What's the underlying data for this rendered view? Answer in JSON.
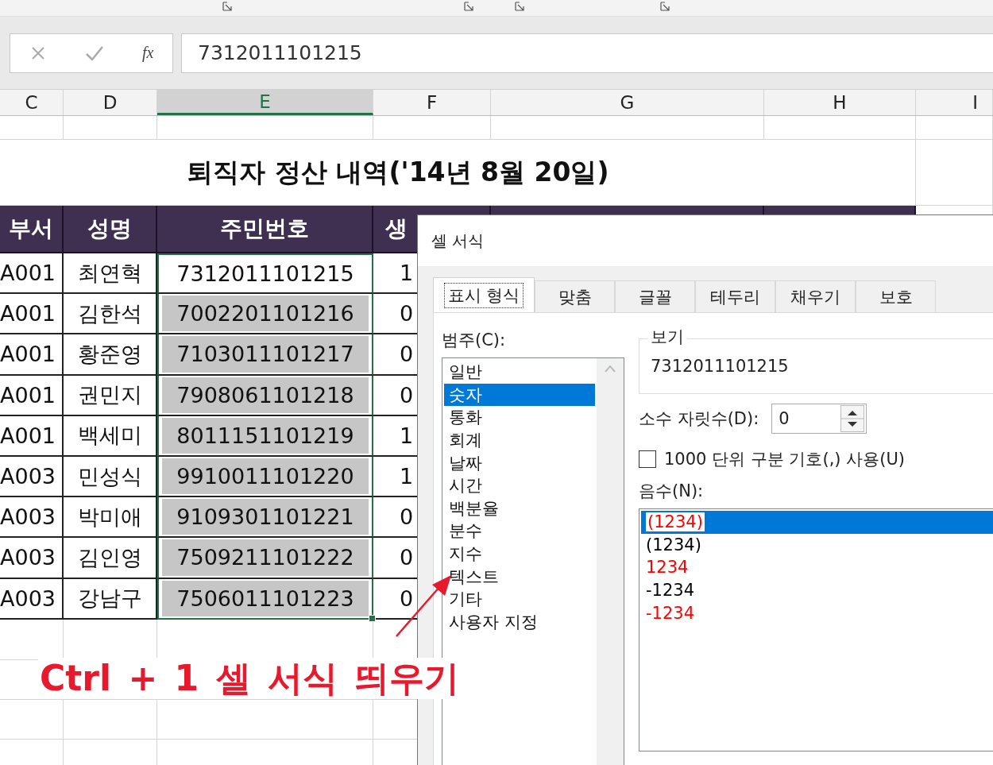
{
  "formula_bar": {
    "function_symbol": "fx",
    "value": "7312011101215"
  },
  "columns": [
    {
      "letter": "C",
      "selected": false
    },
    {
      "letter": "D",
      "selected": false
    },
    {
      "letter": "E",
      "selected": true
    },
    {
      "letter": "F",
      "selected": false
    },
    {
      "letter": "G",
      "selected": false
    },
    {
      "letter": "H",
      "selected": false
    },
    {
      "letter": "I",
      "selected": false
    }
  ],
  "sheet": {
    "title": "퇴직자 정산 내역('14년 8월 20일)",
    "headers": [
      "부서",
      "성명",
      "주민번호",
      "생"
    ],
    "rows": [
      {
        "dept": "A001",
        "name": "최연혁",
        "id": "7312011101215",
        "col_f": "1",
        "active": true
      },
      {
        "dept": "A001",
        "name": "김한석",
        "id": "7002201101216",
        "col_f": "0",
        "active": false
      },
      {
        "dept": "A001",
        "name": "황준영",
        "id": "7103011101217",
        "col_f": "0",
        "active": false
      },
      {
        "dept": "A001",
        "name": "권민지",
        "id": "7908061101218",
        "col_f": "0",
        "active": false
      },
      {
        "dept": "A001",
        "name": "백세미",
        "id": "8011151101219",
        "col_f": "1",
        "active": false
      },
      {
        "dept": "A003",
        "name": "민성식",
        "id": "9910011101220",
        "col_f": "1",
        "active": false
      },
      {
        "dept": "A003",
        "name": "박미애",
        "id": "9109301101221",
        "col_f": "0",
        "active": false
      },
      {
        "dept": "A003",
        "name": "김인영",
        "id": "7509211101222",
        "col_f": "0",
        "active": false
      },
      {
        "dept": "A003",
        "name": "강남구",
        "id": "7506011101223",
        "col_f": "0",
        "active": false
      }
    ]
  },
  "annotation": "Ctrl + 1 셀 서식 띄우기",
  "dialog": {
    "title": "셀 서식",
    "tabs": [
      {
        "label": "표시 형식",
        "selected": true
      },
      {
        "label": "맞춤",
        "selected": false
      },
      {
        "label": "글꼴",
        "selected": false
      },
      {
        "label": "테두리",
        "selected": false
      },
      {
        "label": "채우기",
        "selected": false
      },
      {
        "label": "보호",
        "selected": false
      }
    ],
    "category_label": "범주(C):",
    "categories": [
      {
        "label": "일반",
        "selected": false
      },
      {
        "label": "숫자",
        "selected": true
      },
      {
        "label": "통화",
        "selected": false
      },
      {
        "label": "회계",
        "selected": false
      },
      {
        "label": "날짜",
        "selected": false
      },
      {
        "label": "시간",
        "selected": false
      },
      {
        "label": "백분율",
        "selected": false
      },
      {
        "label": "분수",
        "selected": false
      },
      {
        "label": "지수",
        "selected": false
      },
      {
        "label": "텍스트",
        "selected": false
      },
      {
        "label": "기타",
        "selected": false
      },
      {
        "label": "사용자 지정",
        "selected": false
      }
    ],
    "sample_label": "보기",
    "sample_value": "7312011101215",
    "decimal_label": "소수 자릿수(D):",
    "decimal_value": "0",
    "separator": {
      "label": "1000 단위 구분 기호(,) 사용(U)",
      "checked": false
    },
    "negative_label": "음수(N):",
    "negatives": [
      {
        "label": "(1234)",
        "color": "#ff0000",
        "selected": true
      },
      {
        "label": "(1234)",
        "color": "#000000",
        "selected": false
      },
      {
        "label": "1234",
        "color": "#ff0000",
        "selected": false
      },
      {
        "label": "-1234",
        "color": "#000000",
        "selected": false
      },
      {
        "label": "-1234",
        "color": "#ff0000",
        "selected": false
      }
    ]
  }
}
